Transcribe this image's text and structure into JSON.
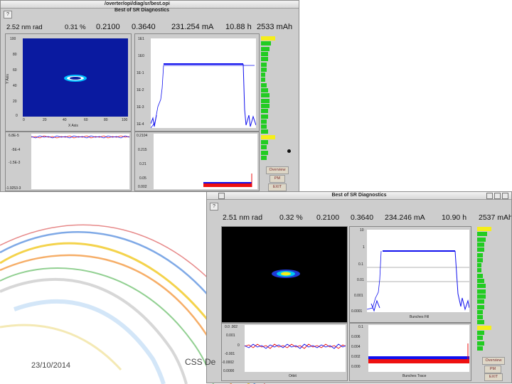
{
  "windows": [
    {
      "title": "Best of SR Diagnostics",
      "path": "/overter/opi/diag/sr/best.opi",
      "help_label": "?",
      "stats": {
        "emittance": "2.52 nm rad",
        "coupling": "0.31 %",
        "tune_x": "0.2100",
        "tune_y": "0.3640",
        "current": "231.254 mA",
        "lifetime": "10.88 h",
        "charge": "2533 mAh"
      },
      "beam_image": {
        "xlabel": "X Axis",
        "ylabel": "Y Axis",
        "x_ticks": [
          "0",
          "20",
          "40",
          "60",
          "80",
          "100"
        ],
        "y_ticks": [
          "100",
          "80",
          "60",
          "40",
          "20",
          "0"
        ]
      },
      "fill_pattern": {
        "y_ticks": [
          "1E1",
          "1E0",
          "1E-1",
          "1E-2",
          "1E-3",
          "1E-4"
        ]
      },
      "orbit": {
        "y_ticks": [
          "6.8E-5",
          "-5E-4",
          "-1.5E-3",
          "-1.9253-3"
        ]
      },
      "bunch_trace": {
        "y_ticks": [
          "0.2104",
          "0.215",
          "0.21",
          "0.05",
          "0.002"
        ]
      },
      "buttons": {
        "overview": "Overview",
        "pm": "PM",
        "exit": "EXIT"
      }
    },
    {
      "title": "Best of SR Diagnostics",
      "help_label": "?",
      "stats": {
        "emittance": "2.51 nm rad",
        "coupling": "0.32 %",
        "tune_x": "0.2100",
        "tune_y": "0.3640",
        "current": "234.246 mA",
        "lifetime": "10.90 h",
        "charge": "2537 mAh"
      },
      "fill_pattern": {
        "y_ticks": [
          "10",
          "1",
          "0.1",
          "0.01",
          "0.001",
          "0.0001"
        ],
        "xlabel": "Bunches Fill"
      },
      "orbit": {
        "y_ticks": [
          "0.0 .002",
          "0.001",
          "0",
          "-0.001",
          "-0.0002",
          "0.0000"
        ],
        "xlabel": "Orbit"
      },
      "bunch_trace": {
        "y_ticks": [
          "0.1",
          "0.006",
          "0.004",
          "0.002",
          "0.000"
        ],
        "xlabel": "Bunches Trace"
      },
      "buttons": {
        "overview": "Overview",
        "pm": "PM",
        "exit": "EXIT"
      }
    }
  ],
  "footer": {
    "date": "23/10/2014",
    "event": "CSS De"
  },
  "colors": {
    "window_bg": "#cdcdcd",
    "status_green": "#22cc22",
    "status_yellow": "#f5ee1a",
    "trace_blue": "#1010ee",
    "trace_red": "#ee1010",
    "beam_bg_1": "#0a1aa0",
    "beam_bg_2": "#000000"
  },
  "status_column_1": [
    "yellow",
    "green",
    "green",
    "green",
    "green",
    "green",
    "green",
    "green",
    "green",
    "green",
    "green",
    "green",
    "green",
    "green",
    "green",
    "green",
    "green",
    "green",
    "green",
    "yellow",
    "green",
    "green",
    "green",
    "green"
  ],
  "status_column_2": [
    "yellow",
    "green",
    "green",
    "green",
    "green",
    "green",
    "green",
    "green",
    "green",
    "green",
    "green",
    "green",
    "green",
    "green",
    "green",
    "green",
    "green",
    "green",
    "green",
    "yellow",
    "green",
    "green",
    "green",
    "green"
  ]
}
